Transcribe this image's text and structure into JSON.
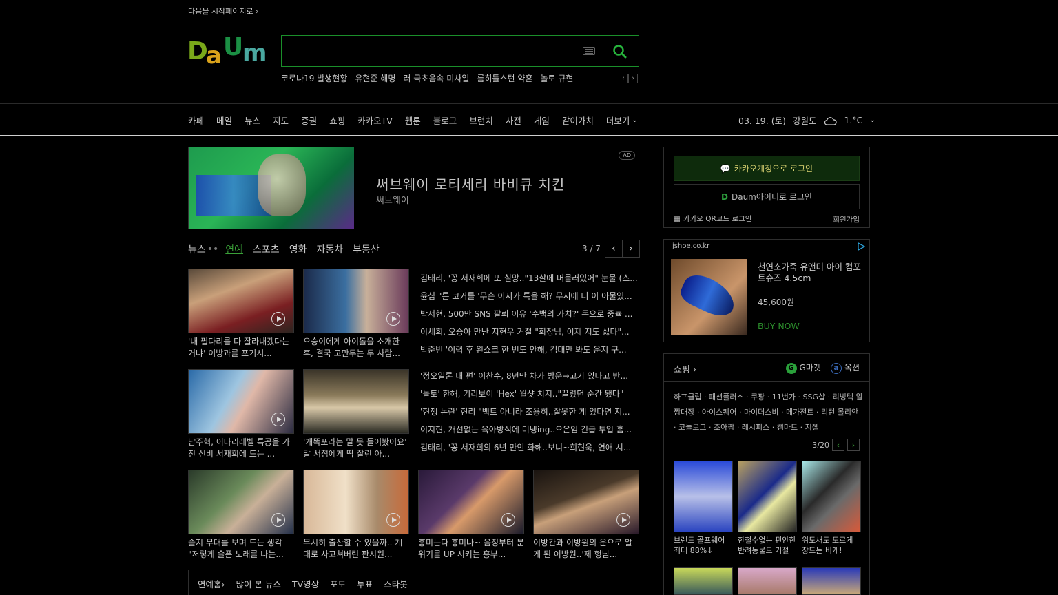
{
  "top": {
    "start_page": "다음을 시작페이지로"
  },
  "logo": {
    "text": "Daum"
  },
  "search": {
    "placeholder": "",
    "value": ""
  },
  "trends": [
    "코로나19 발생현황",
    "유현준 해명",
    "러 극초음속 미사일",
    "름히틀스턴 약혼",
    "놀토 규현"
  ],
  "nav": {
    "items": [
      "카페",
      "메일",
      "뉴스",
      "지도",
      "증권",
      "쇼핑",
      "카카오TV",
      "웹툰",
      "블로그",
      "브런치",
      "사전",
      "게임",
      "같이가치"
    ],
    "more": "더보기"
  },
  "weather": {
    "date": "03. 19. (토)",
    "region": "강원도",
    "temp": "1.°C"
  },
  "ad": {
    "badge": "AD",
    "title": "써브웨이 로티세리 바비큐 치킨",
    "sub": "써브웨이"
  },
  "news": {
    "tabs": [
      "뉴스",
      "연예",
      "스포츠",
      "영화",
      "자동차",
      "부동산"
    ],
    "dots": "••",
    "active_index": 1,
    "pager": "3 / 7",
    "thumbs_top": [
      {
        "caption": "'내 필다리를 다 잘라내겠다는 거냐' 이방과를 포기시..."
      },
      {
        "caption": "오승이에게 아이돌을 소개한 후, 결국 고만두는 두 사람..."
      }
    ],
    "headlines_top": [
      "김태리, '꽁 서재희에 또 실망..\"13살에 머물러있어\" 눈물 (스...",
      "윤심 \"튼 코커를 '무슨 이지가 특을 해? 무시에 더 이 아물있...",
      "박서현, 500만 SNS 팔뢰 이유 '수백의 가치?' 돈으로 중뉼 ...",
      "이세희, 오승아 만난 지현우 거절 \"회장님, 이제 저도 싫다\"...",
      "박준빈 '이력 후 왼쇼크 한 번도 안해, 컴대만 봐도 운지 구..."
    ],
    "thumbs_mid": [
      {
        "caption": "남주혁, 이나리레벨 특공을 가진 신비 서재희에 드는 ..."
      },
      {
        "caption": "'개똑포라는 말 못 들어봤어요' 말 서점에게 딱 잘린 아..."
      }
    ],
    "headlines_mid": [
      "'정오일론 내 편' 이찬수, 8년만 차가 방운→고기 있다고 반...",
      "'놀토' 한해, 기리보이 'Hex' 월샷 치지..\"끌렸던 순간 됐다\"",
      "'현쟁 논란' 현리 \"백트 아니라 조용히..잘못한 게 있다면 지...",
      "이지현, 개선없는 육아방식에 미냉ing..오은임 긴급 투입 흠...",
      "김태리, '꽁 서재희의 6년 만인 화해..보니~희현욱, 연애 시..."
    ],
    "thumbs_bottom": [
      {
        "caption": "슬지 무대를 보며 드는 생각 \"저렇게 슬픈 노래를 나는..."
      },
      {
        "caption": "무시히 출산할 수 있을까.. 계대로 사고쳐버린 판시원..."
      },
      {
        "caption": "흥미는다 흥미나~ 음정부터 분위기를 UP 시키는 흥부..."
      },
      {
        "caption": "이방간과 이방원의 운으로 알게 된 이방원..'제 형님..."
      }
    ]
  },
  "sub_links": [
    "연예홈",
    "많이 본 뉴스",
    "TV영상",
    "포토",
    "투표",
    "스타봇"
  ],
  "login": {
    "kakao": "카카오계정으로 로그인",
    "daum": "Daum아이디로 로그인",
    "qr": "카카오 QR코드 로그인",
    "join": "회원가입"
  },
  "shop_ad": {
    "domain": "jshoe.co.kr",
    "title": "천연소가죽 유앤미 아이 컴포트슈즈 4.5cm",
    "price": "45,600원",
    "buy": "BUY NOW"
  },
  "shopping": {
    "title": "쇼핑",
    "brands": [
      "G마켓",
      "옥션"
    ],
    "links": "하프클럽 · 패션플러스 · 쿠팡 · 11번가 · SSG샵 · 리빙텍 알짬대장 · 아이스퀘어 · 마이더스비 · 메가전트 · 리턴 몰리안 · 코놀로그 · 조아팜 · 레시피스 · 캠마트 · 지젤",
    "pager": "3/20",
    "items": [
      {
        "caption": "브랜드 골프웨어 최대 88%↓"
      },
      {
        "caption": "한철수없는 편안한 반려동물도 기절"
      },
      {
        "caption": "위도새도 도르게 장드는 비개!"
      }
    ]
  },
  "colors": {
    "accent": "#3aa038",
    "border": "#2e2e2e",
    "bg": "#000000"
  }
}
